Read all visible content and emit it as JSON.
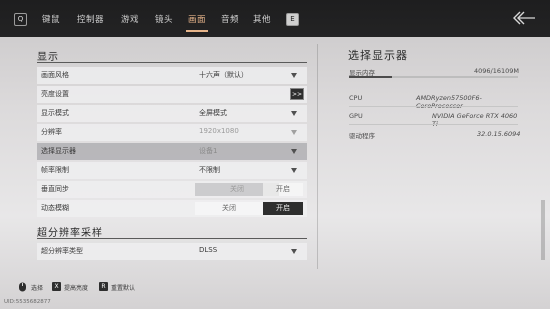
{
  "topbar": {
    "left_key": "Q",
    "right_key": "E",
    "tabs": [
      {
        "label": "键鼠",
        "active": false
      },
      {
        "label": "控制器",
        "active": false
      },
      {
        "label": "游戏",
        "active": false
      },
      {
        "label": "镜头",
        "active": false
      },
      {
        "label": "画面",
        "active": true
      },
      {
        "label": "音频",
        "active": false
      },
      {
        "label": "其他",
        "active": false
      }
    ],
    "back_icon": "back-arrow-icon"
  },
  "display_section": {
    "title": "显示",
    "rows": [
      {
        "label": "画面风格",
        "value": "十六声（默认）",
        "type": "dropdown"
      },
      {
        "label": "亮度设置",
        "type": "arrow_button",
        "button": ">>"
      },
      {
        "label": "显示模式",
        "value": "全屏模式",
        "type": "dropdown"
      },
      {
        "label": "分辨率",
        "value": "1920x1080",
        "type": "dropdown",
        "disabled": true
      },
      {
        "label": "选择显示器",
        "value": "设备1",
        "type": "dropdown",
        "disabled": true,
        "highlighted": true
      },
      {
        "label": "帧率限制",
        "value": "不限制",
        "type": "dropdown"
      },
      {
        "label": "垂直同步",
        "type": "toggle",
        "off_label": "关闭",
        "on_label": "开启",
        "selected": "off",
        "disabled": true
      },
      {
        "label": "动态模糊",
        "type": "toggle",
        "off_label": "关闭",
        "on_label": "开启",
        "selected": "on"
      }
    ]
  },
  "upscale_section": {
    "title": "超分辨率采样",
    "rows": [
      {
        "label": "超分辨率类型",
        "value": "DLSS",
        "type": "dropdown"
      }
    ]
  },
  "right_panel": {
    "title": "选择显示器",
    "memory_label": "显示内存",
    "memory_value": "4096/16109M",
    "memory_fraction": 0.254,
    "cpu_label": "CPU",
    "cpu_value": "AMDRyzen57500F6-CoreProcessor",
    "gpu_label": "GPU",
    "gpu_value": "NVIDIA GeForce RTX 4060 Ti",
    "driver_label": "驱动程序",
    "driver_value": "32.0.15.6094"
  },
  "bottom_hints": [
    {
      "key": "◖",
      "label": "选择"
    },
    {
      "key": "X",
      "label": "提高亮度"
    },
    {
      "key": "R",
      "label": "重置默认"
    }
  ],
  "uid": "UID:5535682877"
}
